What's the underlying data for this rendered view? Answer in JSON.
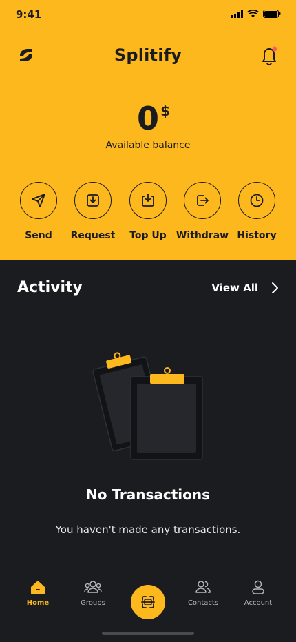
{
  "status": {
    "time": "9:41"
  },
  "header": {
    "title": "Splitify"
  },
  "balance": {
    "amount": "0",
    "currency": "$",
    "label": "Available balance"
  },
  "actions": [
    {
      "label": "Send"
    },
    {
      "label": "Request"
    },
    {
      "label": "Top Up"
    },
    {
      "label": "Withdraw"
    },
    {
      "label": "History"
    }
  ],
  "activity": {
    "title": "Activity",
    "view_all": "View All"
  },
  "empty": {
    "title": "No Transactions",
    "text": "You haven't made any transactions."
  },
  "tabs": [
    {
      "label": "Home"
    },
    {
      "label": "Groups"
    },
    {
      "label": "Contacts"
    },
    {
      "label": "Account"
    }
  ],
  "colors": {
    "accent": "#fdb81e",
    "background": "#1b1c20"
  }
}
